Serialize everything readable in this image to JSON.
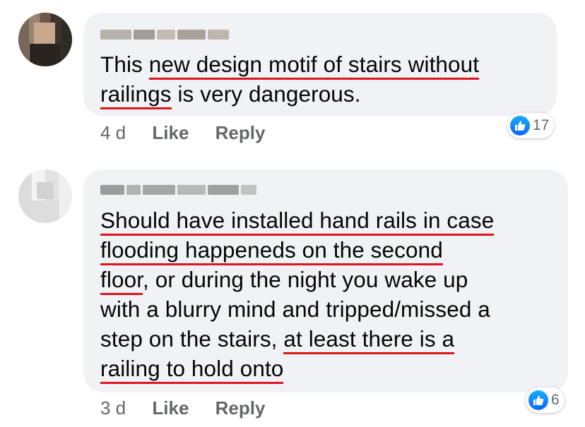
{
  "comments": [
    {
      "author": "Pixelated name",
      "text_lines": [
        [
          {
            "t": "This "
          },
          {
            "t": "new design motif of stairs without",
            "u": true
          }
        ],
        [
          {
            "t": "railings",
            "u": true
          },
          {
            "t": " is very dangerous."
          }
        ]
      ],
      "time": "4 d",
      "like_label": "Like",
      "reply_label": "Reply",
      "reaction_icon": "like-icon",
      "reaction_count": "17"
    },
    {
      "author": "Pixelated name",
      "text_lines": [
        [
          {
            "t": "Should have installed hand rails in case",
            "u": true
          }
        ],
        [
          {
            "t": "flooding happeneds on the second",
            "u": true
          }
        ],
        [
          {
            "t": "floor",
            "u": true
          },
          {
            "t": ", or during the night you wake up"
          }
        ],
        [
          {
            "t": "with a blurry mind and tripped/missed a"
          }
        ],
        [
          {
            "t": "step on the stairs, "
          },
          {
            "t": "at least there is a",
            "u": true
          }
        ],
        [
          {
            "t": "railing to hold onto",
            "u": true
          }
        ]
      ],
      "time": "3 d",
      "like_label": "Like",
      "reply_label": "Reply",
      "reaction_icon": "like-icon",
      "reaction_count": "6"
    }
  ],
  "colors": {
    "bubble": "#f0f2f5",
    "underline": "#e0141e",
    "meta": "#65676b",
    "like_blue": "#0866ff"
  }
}
